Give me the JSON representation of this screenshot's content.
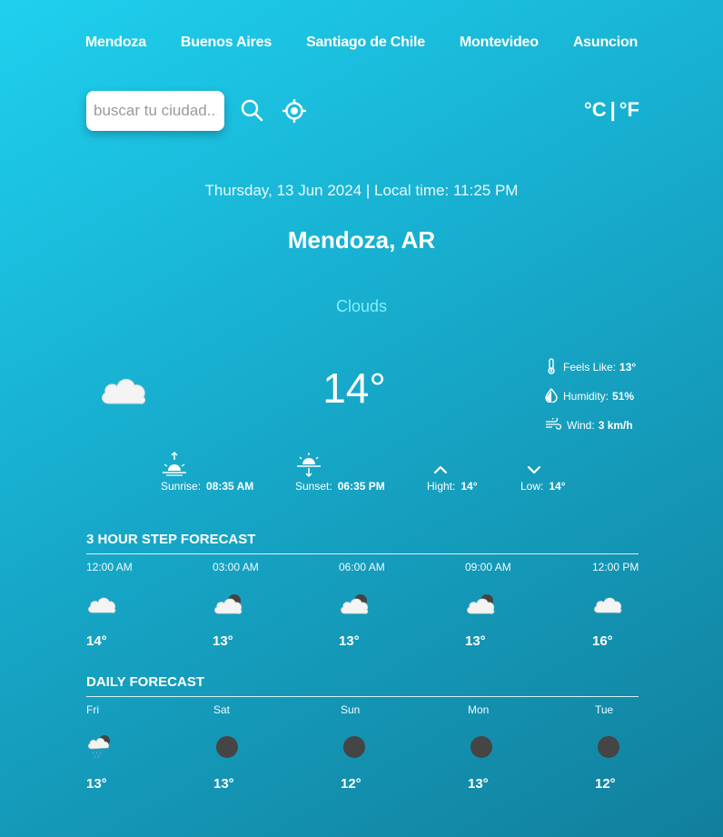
{
  "nav": {
    "cities": [
      "Mendoza",
      "Buenos Aires",
      "Santiago de Chile",
      "Montevideo",
      "Asuncion"
    ]
  },
  "search": {
    "placeholder": "buscar tu ciudad...",
    "search_icon": "search-icon",
    "location_icon": "crosshair-location-icon"
  },
  "units": {
    "celsius": "°C",
    "separator": "|",
    "fahrenheit": "°F"
  },
  "current": {
    "datetime": "Thursday, 13 Jun 2024 | Local time: 11:25 PM",
    "city": "Mendoza, AR",
    "condition": "Clouds",
    "temperature": "14°",
    "icon": "cloud-icon",
    "details": [
      {
        "icon": "thermometer-icon",
        "label": "Feels Like:",
        "value": "13°"
      },
      {
        "icon": "humidity-drop-icon",
        "label": "Humidity:",
        "value": "51%"
      },
      {
        "icon": "wind-icon",
        "label": "Wind:",
        "value": "3 km/h"
      }
    ],
    "sun": [
      {
        "icon": "sunrise-icon",
        "label": "Sunrise:",
        "value": "08:35 AM"
      },
      {
        "icon": "sunset-icon",
        "label": "Sunset:",
        "value": "06:35 PM"
      },
      {
        "icon": "chevron-up-icon",
        "label": "Hight:",
        "value": "14°"
      },
      {
        "icon": "chevron-down-icon",
        "label": "Low:",
        "value": "14°"
      }
    ]
  },
  "hourly": {
    "title": "3 HOUR STEP FORECAST",
    "items": [
      {
        "label": "12:00 AM",
        "icon": "cloud-icon",
        "value": "14°"
      },
      {
        "label": "03:00 AM",
        "icon": "cloud-moon-icon",
        "value": "13°"
      },
      {
        "label": "06:00 AM",
        "icon": "cloud-moon-icon",
        "value": "13°"
      },
      {
        "label": "09:00 AM",
        "icon": "cloud-moon-icon",
        "value": "13°"
      },
      {
        "label": "12:00 PM",
        "icon": "cloud-icon",
        "value": "16°"
      }
    ]
  },
  "daily": {
    "title": "DAILY FORECAST",
    "items": [
      {
        "label": "Fri",
        "icon": "rain-cloud-icon",
        "value": "13°"
      },
      {
        "label": "Sat",
        "icon": "dark-moon-icon",
        "value": "13°"
      },
      {
        "label": "Sun",
        "icon": "dark-moon-icon",
        "value": "12°"
      },
      {
        "label": "Mon",
        "icon": "dark-moon-icon",
        "value": "13°"
      },
      {
        "label": "Tue",
        "icon": "dark-moon-icon",
        "value": "12°"
      }
    ]
  },
  "colors": {
    "bg_start": "#1fd0ee",
    "bg_end": "#117f9c",
    "condition": "#7ff0fb"
  }
}
